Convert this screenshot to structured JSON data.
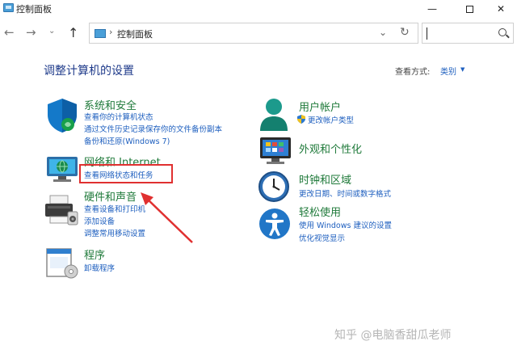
{
  "window": {
    "title": "控制面板",
    "minimize_glyph": "—",
    "close_glyph": "✕"
  },
  "nav": {
    "back_glyph": "←",
    "forward_glyph": "→",
    "recent_glyph": "⌄",
    "up_glyph": "↑",
    "address_separator": "›",
    "address_path": "控制面板",
    "dropdown_glyph": "⌄",
    "refresh_glyph": "↻"
  },
  "main": {
    "heading": "调整计算机的设置",
    "view_by_label": "查看方式:",
    "view_by_value": "类别",
    "view_by_caret": "▼"
  },
  "categories": {
    "system": {
      "icon": "shield-icon",
      "title": "系统和安全",
      "links": [
        "查看你的计算机状态",
        "通过文件历史记录保存你的文件备份副本",
        "备份和还原(Windows 7)"
      ]
    },
    "network": {
      "icon": "network-pc-icon",
      "title": "网络和 Internet",
      "links": [
        "查看网络状态和任务"
      ]
    },
    "hardware": {
      "icon": "printer-icon",
      "title": "硬件和声音",
      "links": [
        "查看设备和打印机",
        "添加设备",
        "调整常用移动设置"
      ]
    },
    "programs": {
      "icon": "program-icon",
      "title": "程序",
      "links": [
        "卸载程序"
      ]
    },
    "user": {
      "icon": "user-icon",
      "title": "用户帐户",
      "links": [
        "更改帐户类型"
      ]
    },
    "appearance": {
      "icon": "appearance-icon",
      "title": "外观和个性化",
      "links": []
    },
    "clock": {
      "icon": "clock-icon",
      "title": "时钟和区域",
      "links": [
        "更改日期、时间或数字格式"
      ]
    },
    "ease": {
      "icon": "accessibility-icon",
      "title": "轻松使用",
      "links": [
        "使用 Windows 建议的设置",
        "优化视觉显示"
      ]
    }
  },
  "watermark": "知乎 @电脑香甜瓜老师",
  "colors": {
    "category_title": "#1f7a3a",
    "link": "#1e5fbf",
    "heading": "#1e3a8a",
    "highlight": "#e03030"
  }
}
